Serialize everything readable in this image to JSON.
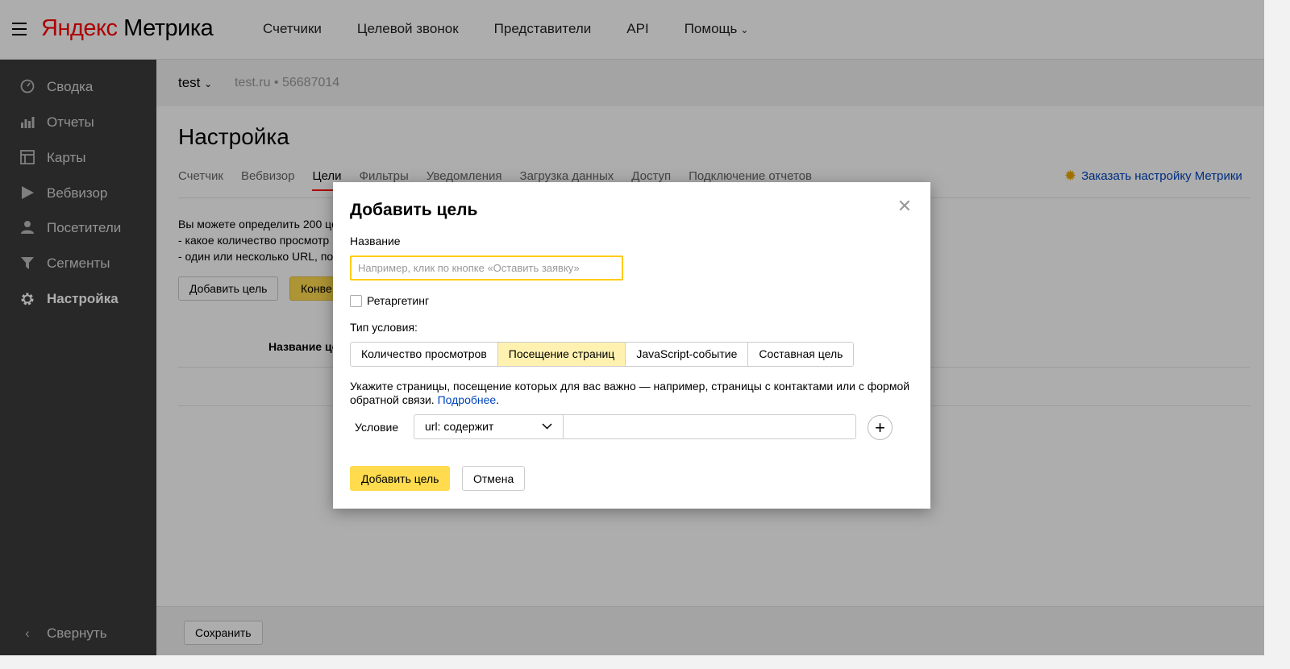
{
  "header": {
    "logo_brand": "Яндекс",
    "logo_product": "Метрика",
    "nav": [
      "Счетчики",
      "Целевой звонок",
      "Представители",
      "API",
      "Помощь"
    ]
  },
  "sidebar": {
    "items": [
      {
        "label": "Сводка",
        "icon": "gauge-icon"
      },
      {
        "label": "Отчеты",
        "icon": "bar-chart-icon"
      },
      {
        "label": "Карты",
        "icon": "map-icon"
      },
      {
        "label": "Вебвизор",
        "icon": "play-icon"
      },
      {
        "label": "Посетители",
        "icon": "user-icon"
      },
      {
        "label": "Сегменты",
        "icon": "filter-icon"
      },
      {
        "label": "Настройка",
        "icon": "gear-icon",
        "active": true
      }
    ],
    "collapse_label": "Свернуть"
  },
  "counter": {
    "name": "test",
    "site": "test.ru",
    "separator": "•",
    "id": "56687014"
  },
  "page": {
    "title": "Настройка",
    "tabs": [
      "Счетчик",
      "Вебвизор",
      "Цели",
      "Фильтры",
      "Уведомления",
      "Загрузка данных",
      "Доступ",
      "Подключение отчетов"
    ],
    "active_tab": "Цели",
    "order_link": "Заказать настройку Метрики",
    "intro_lines": [
      "Вы можете определить 200 це",
      "-  какое количество просмотр",
      "-  один или несколько URL, по"
    ],
    "add_goal_button": "Добавить цель",
    "conversions_button": "Конве",
    "table_header": "Название це",
    "save_button": "Сохранить"
  },
  "modal": {
    "title": "Добавить цель",
    "name_label": "Название",
    "name_placeholder": "Например, клик по кнопке «Оставить заявку»",
    "retargeting_label": "Ретаргетинг",
    "condition_type_label": "Тип условия:",
    "condition_types": [
      "Количество просмотров",
      "Посещение страниц",
      "JavaScript-событие",
      "Составная цель"
    ],
    "active_condition_type": "Посещение страниц",
    "hint_text": "Укажите страницы, посещение которых для вас важно — например, страницы с контактами или с формой обратной связи. ",
    "hint_link": "Подробнее",
    "hint_end": ".",
    "condition_label": "Условие",
    "condition_select": "url: содержит",
    "condition_value": "",
    "add_button": "Добавить цель",
    "cancel_button": "Отмена"
  },
  "colors": {
    "accent_yellow": "#ffdb4d",
    "active_segment": "#fff2b0",
    "link": "#0044bb",
    "sidebar_bg": "#3b3b3b"
  }
}
